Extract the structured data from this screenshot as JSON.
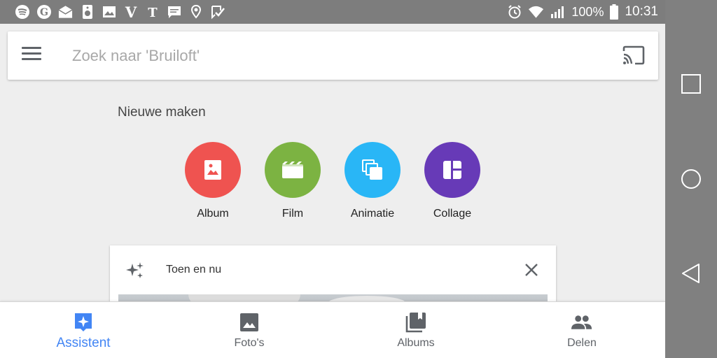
{
  "status_bar": {
    "left_icons": [
      "spotify-icon",
      "g-logo-icon",
      "mail-icon",
      "speaker-icon",
      "image-icon",
      "v-logo-icon",
      "nyt-icon",
      "message-icon",
      "maps-icon",
      "checkmark-icon"
    ],
    "battery": "100%",
    "time": "10:31"
  },
  "search": {
    "placeholder": "Zoek naar 'Bruiloft'"
  },
  "create_section": {
    "title": "Nieuwe maken",
    "items": [
      {
        "label": "Album",
        "color": "#ef5350",
        "icon": "album-icon"
      },
      {
        "label": "Film",
        "color": "#7cb342",
        "icon": "film-icon"
      },
      {
        "label": "Animatie",
        "color": "#29b6f6",
        "icon": "animation-icon"
      },
      {
        "label": "Collage",
        "color": "#673ab7",
        "icon": "collage-icon"
      }
    ]
  },
  "card": {
    "title": "Toen en nu"
  },
  "bottom_nav": {
    "items": [
      {
        "label": "Assistent",
        "active": true
      },
      {
        "label": "Foto's",
        "active": false
      },
      {
        "label": "Albums",
        "active": false
      },
      {
        "label": "Delen",
        "active": false
      }
    ]
  },
  "colors": {
    "accent": "#4285f4",
    "status_bar": "#7d7d7d",
    "system_nav": "#808080"
  }
}
